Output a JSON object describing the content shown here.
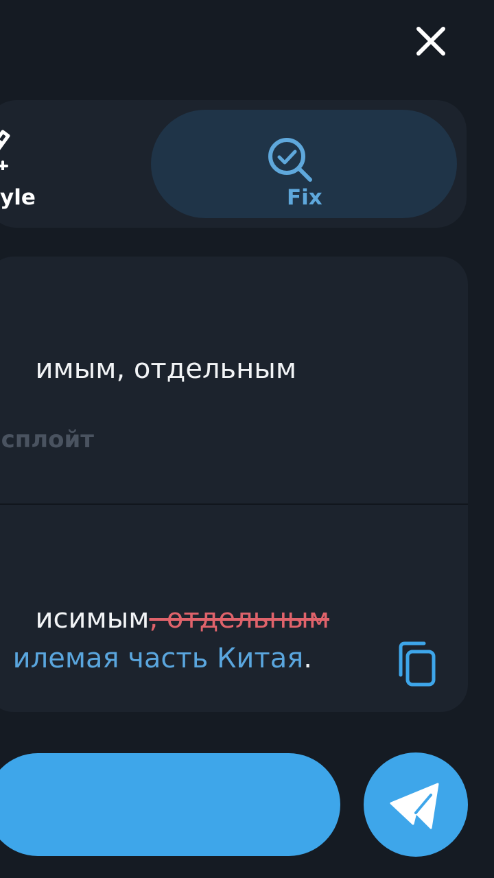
{
  "header": {
    "close_icon": "close-icon"
  },
  "modes": {
    "style": {
      "label": "yle",
      "icon": "pen-sparkle-icon"
    },
    "fix": {
      "label": "Fix",
      "icon": "magnifier-check-icon"
    }
  },
  "original": {
    "line1": "имым, отдельным",
    "line2": "сплойт"
  },
  "corrected": {
    "line1_kept": "исимым",
    "line1_removed": ", отдельным",
    "line2_added": "илемая часть Китая",
    "line2_end": "."
  },
  "actions": {
    "copy_icon": "copy-icon",
    "send_icon": "send-icon"
  },
  "colors": {
    "background": "#151b23",
    "panel": "#1c232d",
    "accent": "#3ea6ea",
    "deleted_text": "#e0636b",
    "added_text": "#5aa6de"
  }
}
